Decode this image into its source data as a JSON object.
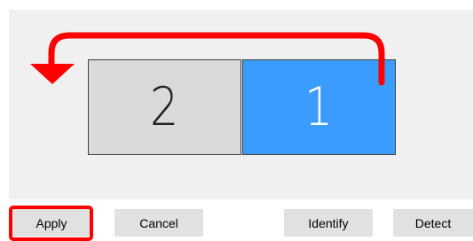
{
  "monitors": [
    {
      "number": "2",
      "selected": false
    },
    {
      "number": "1",
      "selected": true
    }
  ],
  "buttons": {
    "apply": "Apply",
    "cancel": "Cancel",
    "identify": "Identify",
    "detect": "Detect"
  },
  "colors": {
    "selected_monitor": "#3a9cff",
    "unselected_monitor": "#dadada",
    "annotation": "#ff0000",
    "arrange_background": "#f0f0f0"
  }
}
